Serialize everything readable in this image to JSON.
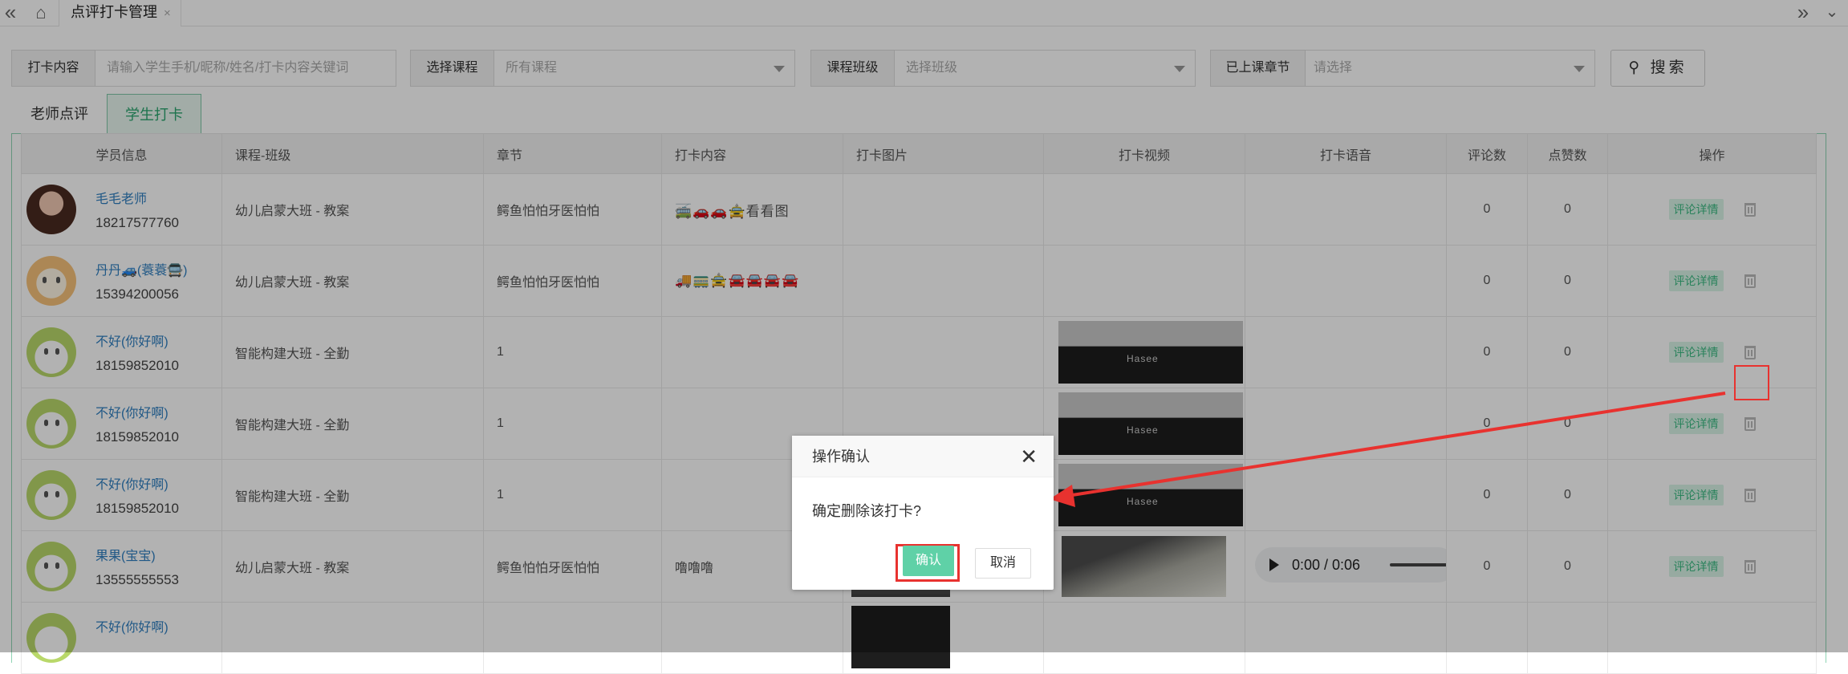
{
  "tabs": {
    "active_label": "点评打卡管理",
    "close": "×"
  },
  "filters": {
    "content_label": "打卡内容",
    "content_placeholder": "请输入学生手机/昵称/姓名/打卡内容关键词",
    "course_label": "选择课程",
    "course_value": "所有课程",
    "class_label": "课程班级",
    "class_value": "选择班级",
    "chapter_label": "已上课章节",
    "chapter_value": "请选择",
    "search_label": "搜索"
  },
  "subtabs": {
    "teacher": "老师点评",
    "student": "学生打卡"
  },
  "table": {
    "headers": [
      "学员信息",
      "课程-班级",
      "章节",
      "打卡内容",
      "打卡图片",
      "打卡视频",
      "打卡语音",
      "评论数",
      "点赞数",
      "操作"
    ],
    "rows": [
      {
        "name": "毛毛老师",
        "phone": "18217577760",
        "course": "幼儿启蒙大班 - 教案",
        "chapter": "鳄鱼怕怕牙医怕怕",
        "content": "🚎🚗🚗🚖看看图",
        "comments": "0",
        "likes": "0"
      },
      {
        "name": "丹丹🚙(蓑蓑🚍)",
        "phone": "15394200056",
        "course": "幼儿启蒙大班 - 教案",
        "chapter": "鳄鱼怕怕牙医怕怕",
        "content": "🚚🚃🚖🚘🚘🚘🚘",
        "comments": "0",
        "likes": "0"
      },
      {
        "name": "不好(你好啊)",
        "phone": "18159852010",
        "course": "智能构建大班 - 全勤",
        "chapter": "1",
        "content": "",
        "comments": "0",
        "likes": "0"
      },
      {
        "name": "不好(你好啊)",
        "phone": "18159852010",
        "course": "智能构建大班 - 全勤",
        "chapter": "1",
        "content": "",
        "comments": "0",
        "likes": "0"
      },
      {
        "name": "不好(你好啊)",
        "phone": "18159852010",
        "course": "智能构建大班 - 全勤",
        "chapter": "1",
        "content": "",
        "comments": "0",
        "likes": "0"
      },
      {
        "name": "果果(宝宝)",
        "phone": "13555555553",
        "course": "幼儿启蒙大班 - 教案",
        "chapter": "鳄鱼怕怕牙医怕怕",
        "content": "噜噜噜",
        "comments": "0",
        "likes": "0"
      },
      {
        "name": "不好(你好啊)",
        "phone": "",
        "course": "",
        "chapter": "",
        "content": "",
        "comments": "",
        "likes": ""
      }
    ],
    "detail_label": "评论详情",
    "video_brand": "Hasee",
    "audio_time": "0:00 / 0:06"
  },
  "modal": {
    "title": "操作确认",
    "close": "✕",
    "message": "确定删除该打卡?",
    "confirm": "确认",
    "cancel": "取消"
  },
  "colors": {
    "accent": "#5fd1a7",
    "highlight": "#e8322f",
    "link": "#2f7fc1"
  }
}
